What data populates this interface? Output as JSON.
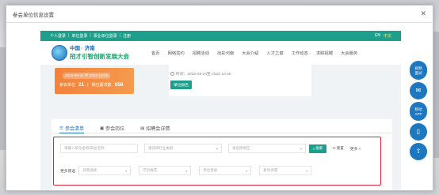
{
  "modal": {
    "title": "参会单位信息设置"
  },
  "topbar": {
    "links": [
      "个人登录",
      "单位登录",
      "事业单位登录",
      "注册"
    ],
    "lang_en": "EN",
    "lang_zh": "中文"
  },
  "logo": {
    "line1": "中国 · 济南",
    "line2": "招才引智创新发展大会"
  },
  "nav": [
    "首页",
    "网络签约",
    "招聘活动",
    "出彩河南",
    "大会介绍",
    "人才之窗",
    "工作动态",
    "求职招聘",
    "大会服务"
  ],
  "event": {
    "date_range": "2022-09-24 至 2022-10-25",
    "units_label": "参会单位",
    "units_count": "21",
    "positions_label": "岗位需求数",
    "positions_count": "658",
    "time_label": "时间：2022-09-24至 2022-10-25",
    "enroll_label": "单位报名"
  },
  "tabs": [
    {
      "label": "参会清单",
      "icon": "list-icon"
    },
    {
      "label": "参会岗位",
      "icon": "briefcase-icon"
    },
    {
      "label": "招聘会详情",
      "icon": "document-icon"
    }
  ],
  "search": {
    "keyword_placeholder": "请输入单位名称/岗位名称",
    "industry_placeholder": "请选择行业类别",
    "region_placeholder": "请选择地区",
    "search_label": "搜索",
    "reset_label": "重置",
    "more_label": "更多",
    "filter_label": "更多筛选",
    "filter1": "日期选择",
    "filter2": "学历要求",
    "filter3": "单位性质",
    "filter4": "薪资待遇"
  },
  "side_tools": [
    {
      "label": "视频\n面试",
      "icon": "video-icon"
    },
    {
      "label": "",
      "icon": "wechat-icon"
    },
    {
      "label": "移动\nAPP",
      "icon": "mobile-app-icon"
    },
    {
      "label": "",
      "icon": "phone-icon"
    },
    {
      "label": "",
      "icon": "back-to-top-icon"
    }
  ],
  "colors": {
    "primary": "#1e9f8c",
    "accent": "#1b6fb7",
    "highlight_border": "#d9283a",
    "card_orange": "#f3823b"
  }
}
